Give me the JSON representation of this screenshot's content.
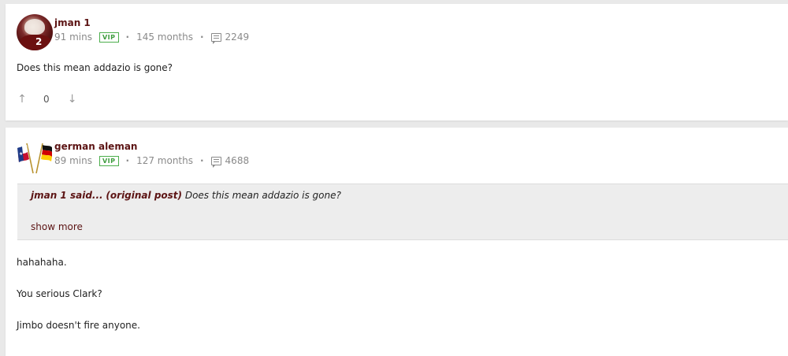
{
  "posts": [
    {
      "username": "jman 1",
      "time": "91 mins",
      "badge": "VIP",
      "tenure": "145 months",
      "post_count": "2249",
      "text": "Does this mean addazio is gone?",
      "votes": "0"
    },
    {
      "username": "german aleman",
      "time": "89 mins",
      "badge": "VIP",
      "tenure": "127 months",
      "post_count": "4688",
      "quote": {
        "author": "jman 1 said...",
        "source": "(original post)",
        "text": " Does this mean addazio is gone?",
        "show_more": "show more"
      },
      "lines": [
        "hahahaha.",
        "You serious Clark?",
        "Jimbo doesn't fire anyone."
      ]
    }
  ],
  "colors": {
    "username": "#5c1414",
    "vip_badge": "#3e9c3e",
    "meta": "#8a8a8a",
    "page_bg": "#e9e9e9",
    "quote_bg": "#ededed"
  },
  "icons": {
    "upvote": "arrow-up-icon",
    "downvote": "arrow-down-icon",
    "post_count": "comment-icon"
  }
}
